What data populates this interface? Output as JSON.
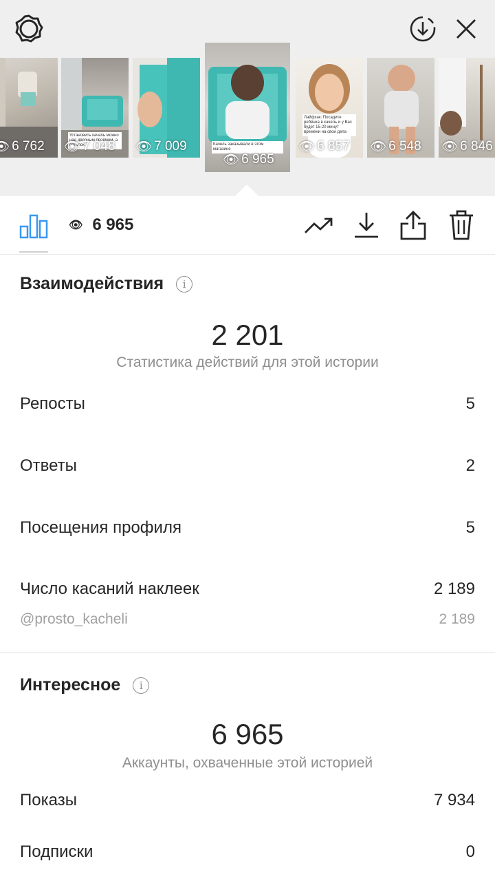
{
  "stories": [
    {
      "views": "6 762"
    },
    {
      "views": "7 048",
      "caption": "Установить качель можно над дверным проёмом, а потолок"
    },
    {
      "views": "7 009"
    },
    {
      "views": "6 965",
      "caption": "Качель заказывали в этом магазине",
      "selected": true
    },
    {
      "views": "6 857",
      "caption": "Лайфхак: Посадите ребёнка в качель и у Вас будет 15-20 минут времени на свои дела"
    },
    {
      "views": "6 548"
    },
    {
      "views": "6 846"
    }
  ],
  "toolbar": {
    "views": "6 965"
  },
  "interactions": {
    "title": "Взаимодействия",
    "total": "2 201",
    "subtitle": "Статистика действий для этой истории",
    "rows": [
      {
        "label": "Репосты",
        "value": "5"
      },
      {
        "label": "Ответы",
        "value": "2"
      },
      {
        "label": "Посещения профиля",
        "value": "5"
      },
      {
        "label": "Число касаний наклеек",
        "value": "2 189"
      }
    ],
    "sticker": {
      "label": "@prosto_kacheli",
      "value": "2 189"
    }
  },
  "discovery": {
    "title": "Интересное",
    "total": "6 965",
    "subtitle": "Аккаунты, охваченные этой историей",
    "rows": [
      {
        "label": "Показы",
        "value": "7 934"
      },
      {
        "label": "Подписки",
        "value": "0"
      }
    ]
  },
  "colors": {
    "accent": "#3897f0",
    "text": "#262626",
    "secondary": "#8e8e8e",
    "topBackground": "#efefef",
    "teal": "#3fb8b2"
  },
  "icons": [
    "settings-icon",
    "download-circle-icon",
    "close-icon",
    "chart-icon",
    "eye-icon",
    "trending-icon",
    "download-icon",
    "share-icon",
    "trash-icon",
    "info-icon"
  ]
}
